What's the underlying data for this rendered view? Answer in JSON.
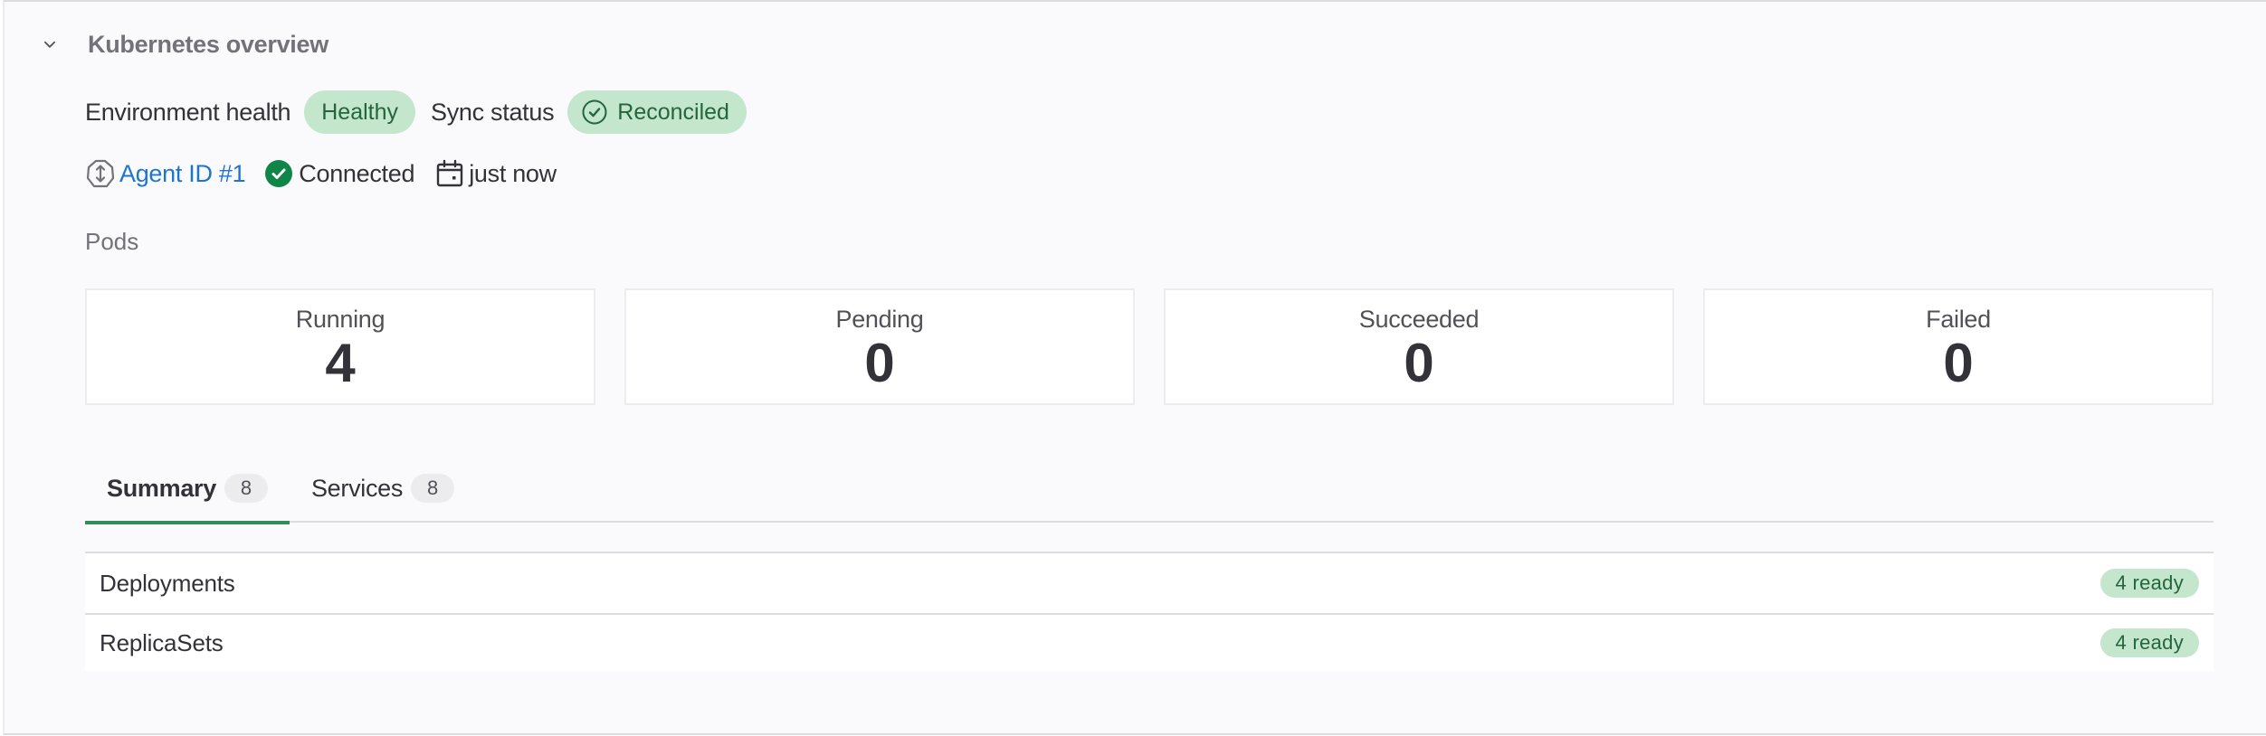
{
  "section": {
    "title": "Kubernetes overview",
    "expanded": true
  },
  "status": {
    "environment_health_label": "Environment health",
    "environment_health_value": "Healthy",
    "sync_status_label": "Sync status",
    "sync_status_value": "Reconciled"
  },
  "agent": {
    "link_text": "Agent ID #1",
    "connection_status": "Connected",
    "last_seen": "just now"
  },
  "pods": {
    "label": "Pods",
    "cards": [
      {
        "label": "Running",
        "value": "4"
      },
      {
        "label": "Pending",
        "value": "0"
      },
      {
        "label": "Succeeded",
        "value": "0"
      },
      {
        "label": "Failed",
        "value": "0"
      }
    ]
  },
  "tabs": [
    {
      "label": "Summary",
      "count": "8",
      "active": true
    },
    {
      "label": "Services",
      "count": "8",
      "active": false
    }
  ],
  "summary_rows": [
    {
      "name": "Deployments",
      "status": "4 ready"
    },
    {
      "name": "ReplicaSets",
      "status": "4 ready"
    }
  ],
  "colors": {
    "success_bg": "#c3e6cd",
    "success_text": "#24663b",
    "link": "#1f75cb",
    "active_tab": "#2f8f57",
    "connected_icon": "#108548"
  }
}
